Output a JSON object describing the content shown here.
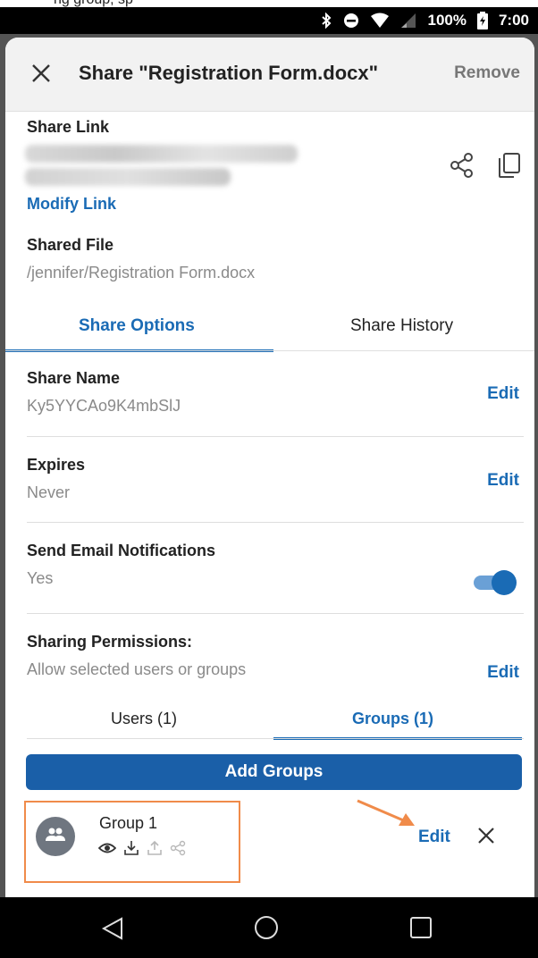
{
  "top_snippet": "ng group, sp",
  "status_bar": {
    "battery_percent": "100%",
    "time": "7:00",
    "icons": [
      "bluetooth-icon",
      "do-not-disturb-icon",
      "wifi-icon",
      "signal-icon",
      "battery-icon"
    ]
  },
  "header": {
    "title": "Share \"Registration Form.docx\"",
    "remove_label": "Remove"
  },
  "share_link": {
    "label": "Share Link",
    "modify_label": "Modify Link"
  },
  "shared_file": {
    "label": "Shared File",
    "path": "/jennifer/Registration Form.docx"
  },
  "tabs": {
    "share_options": "Share Options",
    "share_history": "Share History",
    "active": "share_options"
  },
  "settings": {
    "share_name": {
      "title": "Share Name",
      "value": "Ky5YYCAo9K4mbSlJ",
      "edit": "Edit"
    },
    "expires": {
      "title": "Expires",
      "value": "Never",
      "edit": "Edit"
    },
    "email_notifications": {
      "title": "Send Email Notifications",
      "value": "Yes",
      "enabled": true
    },
    "sharing_permissions": {
      "title": "Sharing Permissions:",
      "value": "Allow selected users or groups",
      "edit": "Edit"
    }
  },
  "permission_tabs": {
    "users": "Users (1)",
    "groups": "Groups (1)",
    "active": "groups"
  },
  "add_groups_label": "Add Groups",
  "group": {
    "name": "Group 1",
    "edit": "Edit",
    "permissions": [
      "view",
      "download",
      "upload",
      "share"
    ],
    "enabled_permissions": [
      "view",
      "download"
    ]
  },
  "colors": {
    "accent": "#1a6bb5",
    "highlight": "#f08b4a"
  }
}
